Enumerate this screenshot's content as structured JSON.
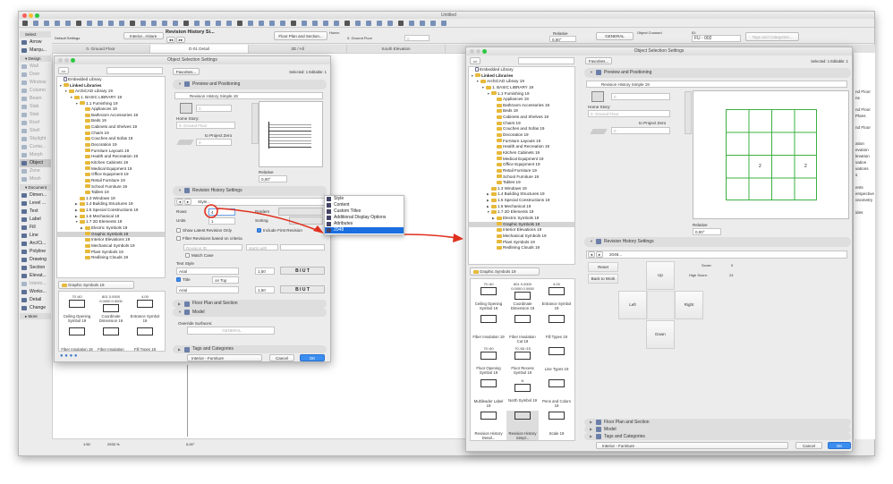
{
  "app": {
    "title": "Untitled"
  },
  "toolbar_main": {
    "info_box": {
      "default_settings": "Default Settings",
      "layer_select": "Interior...rniture",
      "object_name": "Revision History Si...",
      "floor_plan_button": "Floor Plan and Section...",
      "home_label": "Home:",
      "home_story": "0. Ground Floor",
      "elevation_value": "0",
      "relative_label": "Relative",
      "angle_value": "0,00°",
      "surface_button": "GENERAL",
      "crossed_label": "Object Crossed",
      "id_label": "ID:",
      "id_value": "FU - 002",
      "tags_button": "Tags and Categories..."
    }
  },
  "tabs": [
    {
      "label": "0. Ground Floor"
    },
    {
      "label": "D-01 Detail"
    },
    {
      "label": "3D / All"
    },
    {
      "label": "South Elevation"
    }
  ],
  "toolbox": {
    "items": [
      {
        "label": "Select",
        "type": "header"
      },
      {
        "label": "Arrow"
      },
      {
        "label": "Marqu..."
      },
      {
        "label": "▾ Design",
        "type": "header"
      },
      {
        "label": "Wall",
        "dim": true
      },
      {
        "label": "Door",
        "dim": true
      },
      {
        "label": "Window",
        "dim": true
      },
      {
        "label": "Column",
        "dim": true
      },
      {
        "label": "Beam",
        "dim": true
      },
      {
        "label": "Slab",
        "dim": true
      },
      {
        "label": "Stair",
        "dim": true
      },
      {
        "label": "Roof",
        "dim": true
      },
      {
        "label": "Shell",
        "dim": true
      },
      {
        "label": "Skylight",
        "dim": true
      },
      {
        "label": "Curtai...",
        "dim": true
      },
      {
        "label": "Morph",
        "dim": true
      },
      {
        "label": "Object",
        "selected": true
      },
      {
        "label": "Zone",
        "dim": true
      },
      {
        "label": "Mesh",
        "dim": true
      },
      {
        "label": "▾ Document",
        "type": "header"
      },
      {
        "label": "Dimen..."
      },
      {
        "label": "Level ..."
      },
      {
        "label": "Text"
      },
      {
        "label": "Label"
      },
      {
        "label": "Fill"
      },
      {
        "label": "Line"
      },
      {
        "label": "Arc/Ci..."
      },
      {
        "label": "Polyline"
      },
      {
        "label": "Drawing"
      },
      {
        "label": "Section"
      },
      {
        "label": "Elevat..."
      },
      {
        "label": "Interio...",
        "dim": true
      },
      {
        "label": "Works..."
      },
      {
        "label": "Detail"
      },
      {
        "label": "Change"
      },
      {
        "label": "▸ More",
        "type": "header"
      }
    ]
  },
  "status_bar": {
    "scale": "1:50",
    "zoom": "2933 %",
    "angle": "0,00°"
  },
  "library_tree": [
    {
      "label": "Embedded Library",
      "level": 0,
      "kind": "doc"
    },
    {
      "label": "Linked Libraries",
      "level": 0,
      "open": true,
      "bold": true
    },
    {
      "label": "ArchiCAD Library 19",
      "level": 1,
      "open": true
    },
    {
      "label": "1. BASIC LIBRARY 19",
      "level": 2,
      "open": true
    },
    {
      "label": "1.1 Furnishing 19",
      "level": 3,
      "open": true
    },
    {
      "label": "Appliances 19",
      "level": 4
    },
    {
      "label": "Bathroom Accessories 19",
      "level": 4
    },
    {
      "label": "Beds 19",
      "level": 4
    },
    {
      "label": "Cabinets and Shelves 19",
      "level": 4
    },
    {
      "label": "Chairs 19",
      "level": 4
    },
    {
      "label": "Couches and Sofas 19",
      "level": 4
    },
    {
      "label": "Decoration 19",
      "level": 4
    },
    {
      "label": "Furniture Layouts 19",
      "level": 4
    },
    {
      "label": "Health and Recreation 19",
      "level": 4
    },
    {
      "label": "Kitchen Cabinets 19",
      "level": 4
    },
    {
      "label": "Medical Equipment 19",
      "level": 4
    },
    {
      "label": "Office Equipment 19",
      "level": 4
    },
    {
      "label": "Retail Furniture 19",
      "level": 4
    },
    {
      "label": "School Furniture 19",
      "level": 4
    },
    {
      "label": "Tables 19",
      "level": 4
    },
    {
      "label": "1.3 Windows 19",
      "level": 3
    },
    {
      "label": "1.4 Building Structures 19",
      "level": 3,
      "closed": true
    },
    {
      "label": "1.5 Special Constructions 19",
      "level": 3,
      "closed": true
    },
    {
      "label": "1.6 Mechanical 19",
      "level": 3,
      "closed": true
    },
    {
      "label": "1.7 2D Elements 19",
      "level": 3,
      "open": true
    },
    {
      "label": "Electric Symbols 19",
      "level": 4,
      "closed": true
    },
    {
      "label": "Graphic Symbols 19",
      "level": 4,
      "selected": true
    },
    {
      "label": "Interior Elevations 19",
      "level": 4
    },
    {
      "label": "Mechanical Symbols 19",
      "level": 4
    },
    {
      "label": "Plant Symbols 19",
      "level": 4
    },
    {
      "label": "Redlining Clouds 19",
      "level": 4
    }
  ],
  "left_dialog": {
    "title": "Object Selection Settings",
    "folder_select": "Graphic Symbols 19",
    "thumbnails": [
      {
        "label": "Ceiling Opening Symbol 19",
        "caption": "70 /40"
      },
      {
        "label": "Coordinate Dimension 19",
        "caption": "801 0.0000 0.0000 0.0000"
      },
      {
        "label": "Entrance Symbol 19",
        "caption": "4.00"
      },
      {
        "label": "Fiber Insulation 19"
      },
      {
        "label": "Fiber Insulation Cut 19"
      },
      {
        "label": "Fill Types 19"
      }
    ],
    "favorites": "Favorites...",
    "selected_info": "Selected: 1 Editable: 1",
    "preview_header": "Preview and Positioning",
    "object_name": "Revision History Simple 19",
    "elevation_value": "0",
    "home_story_label": "Home Story:",
    "home_story": "0. Ground Floor",
    "to_project_zero": "to Project Zero",
    "zero_value": "0",
    "relative_label": "Relative",
    "angle_value": "0,00°",
    "revision_header": "Revision History Settings",
    "style_button": "Style...",
    "rows_label": "Rows",
    "rows_value": "4",
    "units_label": "Units",
    "units_value": "1",
    "borders_label": "Borders",
    "sorting_label": "Sorting",
    "show_latest": "Show Latest Revision Only",
    "include_first": "Include First Revision",
    "filter_label": "Filter Revisions based on criteria",
    "filter_field": "Revision ID",
    "filter_op": "starts with",
    "match_case": "Match Case",
    "text_style_label": "Text Style",
    "font1": "Arial",
    "size1": "1,50",
    "title_label": "Title",
    "title_pos": "on Top",
    "font2": "Arial",
    "size2": "1,50",
    "floor_plan_header": "Floor Plan and Section",
    "model_header": "Model",
    "override_label": "Override Surfaces:",
    "surface_value": "GENERAL",
    "tags_header": "Tags and Categories",
    "layer": "Interior - Furniture",
    "cancel": "Cancel",
    "ok": "OK"
  },
  "popup_menu": {
    "items": [
      {
        "label": "Style"
      },
      {
        "label": "Content"
      },
      {
        "label": "Custom Titles"
      },
      {
        "label": "Additional Display Options"
      },
      {
        "label": "Attributes"
      },
      {
        "label": "2048",
        "highlighted": true
      }
    ]
  },
  "right_dialog": {
    "title": "Object Selection Settings",
    "folder_select": "Graphic Symbols 19",
    "thumbnails": [
      {
        "label": "Ceiling Opening Symbol 19",
        "caption": "70 /40"
      },
      {
        "label": "Coordinate Dimension 19",
        "caption": "801 0.0000 0.0000 0.0000"
      },
      {
        "label": "Entrance Symbol 19",
        "caption": "4.00"
      },
      {
        "label": "Fiber Insulation 19"
      },
      {
        "label": "Fiber Insulation Cut 19"
      },
      {
        "label": "Fill Types 19"
      },
      {
        "label": "Floor Opening Symbol 19",
        "caption": "70 /40"
      },
      {
        "label": "Floor Recess Symbol 19",
        "caption": "70 /40 /15"
      },
      {
        "label": "Line Types 19"
      },
      {
        "label": "Multileader Label 19"
      },
      {
        "label": "North Symbol 19",
        "caption": "N"
      },
      {
        "label": "Pens and Colors 19"
      },
      {
        "label": "Revision History Detail...",
        "short": "Revision History Detai..."
      },
      {
        "label": "Revision History Simpl...",
        "selected": true
      },
      {
        "label": "Scale 19"
      }
    ],
    "favorites": "Favorites...",
    "selected_info": "Selected: 1 Editable: 1",
    "preview_header": "Preview and Positioning",
    "object_name": "Revision History Simple 19",
    "elevation_value": "0",
    "home_story_label": "Home Story:",
    "home_story": "0. Ground Floor",
    "to_project_zero": "to Project Zero",
    "zero_value": "0",
    "preview_numbers": [
      "2",
      "2"
    ],
    "relative_label": "Relative",
    "angle_value": "0,00°",
    "revision_header": "Revision History Settings",
    "page_button": "2048...",
    "game": {
      "reset": "Reset",
      "back": "Back to Work",
      "up": "Up",
      "left": "Left",
      "right": "Right",
      "down": "Down",
      "score_label": "Score:",
      "score": "0",
      "high_score_label": "High Score:",
      "high_score": "24"
    },
    "floor_plan_header": "Floor Plan and Section",
    "model_header": "Model",
    "tags_header": "Tags and Categories",
    "layer": "Interior - Furniture",
    "cancel": "Cancel",
    "ok": "OK"
  },
  "side_panel": {
    "items": [
      "nd Floor",
      "ns",
      "nd Floor",
      "Plans",
      "nd Floor",
      "ation",
      "evation",
      "levation",
      "vation",
      "vations",
      "s",
      "ents",
      "erspective",
      "onometry",
      "ides"
    ]
  },
  "colors": {
    "accent": "#1a6ee0",
    "annotation": "#e0301e",
    "grid": "#3cb043"
  }
}
